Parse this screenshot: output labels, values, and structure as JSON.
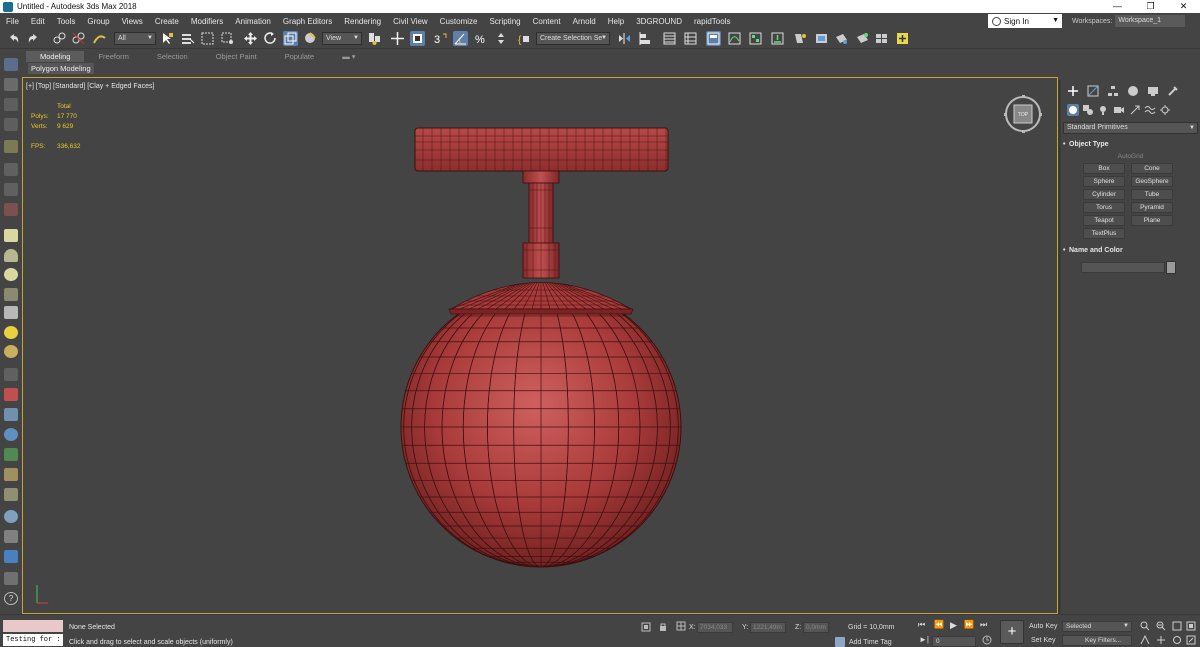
{
  "window": {
    "title": "Untitled - Autodesk 3ds Max 2018"
  },
  "menu": [
    "File",
    "Edit",
    "Tools",
    "Group",
    "Views",
    "Create",
    "Modifiers",
    "Animation",
    "Graph Editors",
    "Rendering",
    "Civil View",
    "Customize",
    "Scripting",
    "Content",
    "Arnold",
    "Help",
    "3DGROUND",
    "rapidTools"
  ],
  "account": {
    "sign_in": "Sign In",
    "workspaces_label": "Workspaces:",
    "workspace_value": "Workspace_1"
  },
  "toolbar": {
    "selection_filter": "All",
    "ref_coord": "View",
    "named_selection": "Create Selection Se"
  },
  "ribbon": {
    "tabs": [
      "Modeling",
      "Freeform",
      "Selection",
      "Object Paint",
      "Populate"
    ],
    "active_tab": "Modeling",
    "subpanel": "Polygon Modeling"
  },
  "viewport": {
    "label": "[+] [Top] [Standard] [Clay + Edged Faces]",
    "stats": {
      "total_label": "Total",
      "polys_label": "Polys:",
      "polys": "17 770",
      "verts_label": "Verts:",
      "verts": "9 629",
      "fps_label": "FPS:",
      "fps": "336,632"
    },
    "object_color": "#a83a3a",
    "highlight_border": "#c8a530"
  },
  "command_panel": {
    "primitive_type": "Standard Primitives",
    "object_type_title": "Object Type",
    "autogrid": "AutoGrid",
    "buttons": [
      "Box",
      "Cone",
      "Sphere",
      "GeoSphere",
      "Cylinder",
      "Tube",
      "Torus",
      "Pyramid",
      "Teapot",
      "Plane",
      "TextPlus"
    ],
    "name_color_title": "Name and Color"
  },
  "status": {
    "maxscript": "Testing for :",
    "selection": "None Selected",
    "prompt": "Click and drag to select and scale objects (uniformly)",
    "x_label": "X:",
    "x_value": "7034,033",
    "y_label": "Y:",
    "y_value": "1221,49m",
    "z_label": "Z:",
    "z_value": "0,0mm",
    "grid": "Grid = 10,0mm",
    "add_time_tag": "Add Time Tag",
    "auto_key": "Auto Key",
    "set_key": "Set Key",
    "key_mode": "Selected",
    "key_filters": "Key Filters...",
    "frame": "0"
  }
}
